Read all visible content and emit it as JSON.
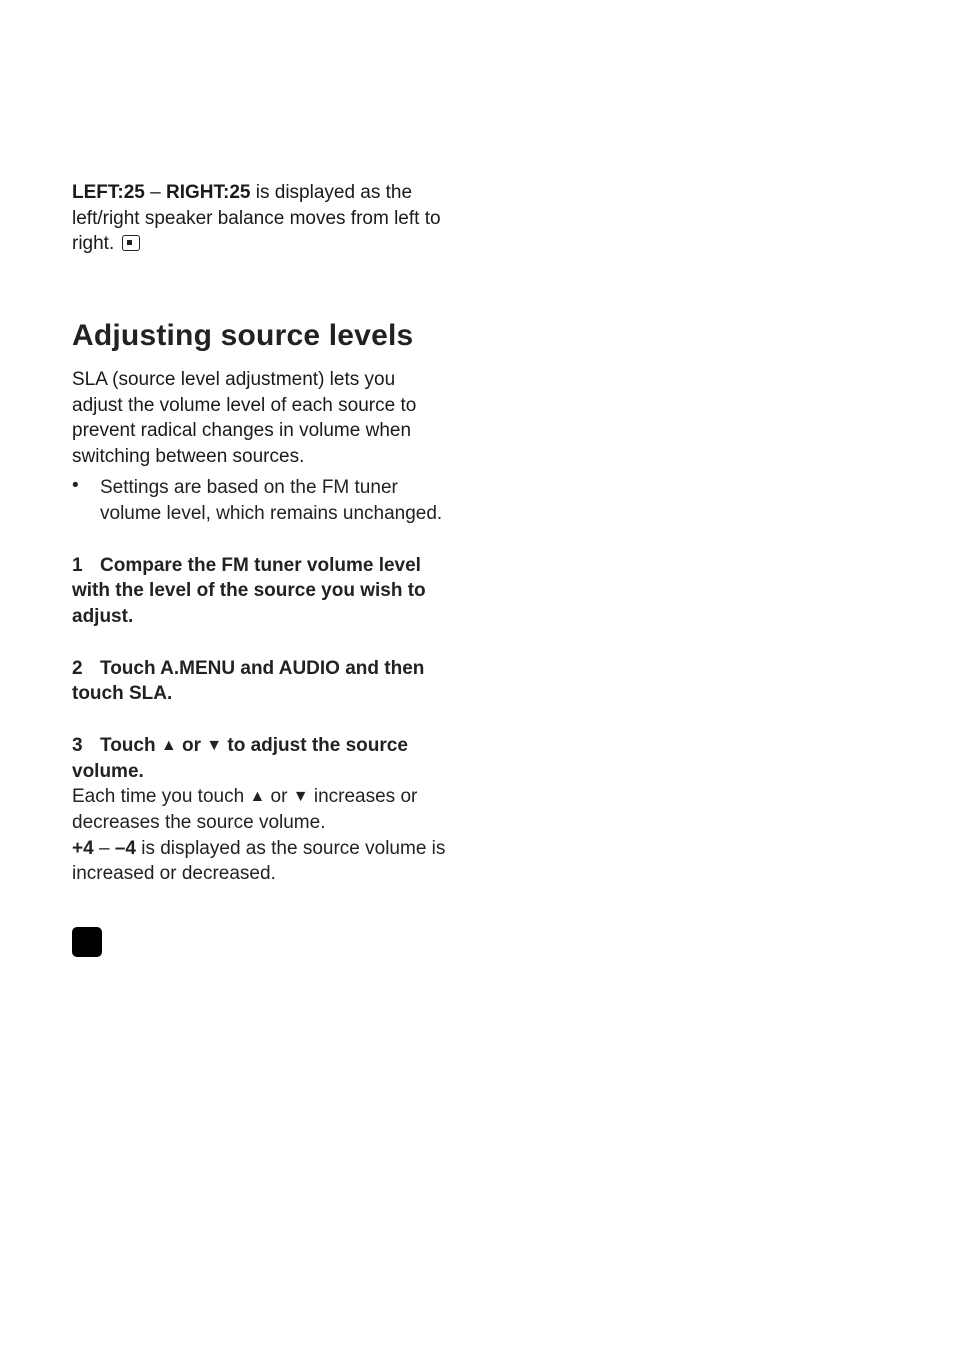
{
  "intro": {
    "left_label": "LEFT:25",
    "dash": "–",
    "right_label": "RIGHT:25",
    "rest": "is displayed as the left/right speaker balance moves from left to right."
  },
  "heading": "Adjusting source levels",
  "body1": "SLA (source level adjustment) lets you adjust the volume level of each source to prevent radical changes in volume when switching between sources.",
  "bullet1": "Settings are based on the FM tuner volume level, which remains unchanged.",
  "steps": {
    "s1": {
      "num": "1",
      "text": "Compare the FM tuner volume level with the level of the source you wish to adjust."
    },
    "s2": {
      "num": "2",
      "text": "Touch A.MENU and AUDIO and then touch SLA."
    },
    "s3": {
      "num": "3",
      "pre": "Touch ",
      "up": "▲",
      "mid": " or ",
      "down": "▼",
      "post": " to adjust the source volume."
    }
  },
  "after3a_pre": "Each time you touch ",
  "after3a_up": "▲",
  "after3a_mid": " or ",
  "after3a_down": "▼",
  "after3a_post": " increases or decreases the source volume.",
  "range_plus": "+4",
  "range_dash": "–",
  "range_minus": "–4",
  "range_rest": "is displayed as the source volume is increased or decreased."
}
